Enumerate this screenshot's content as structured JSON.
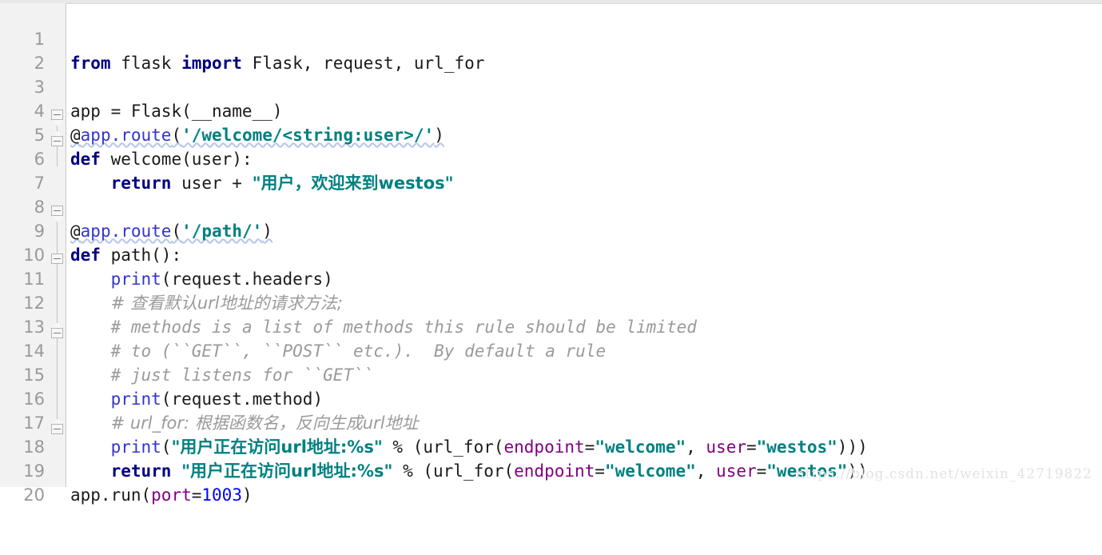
{
  "editor": {
    "language": "python",
    "first_line": 1,
    "last_line": 20,
    "colors": {
      "background": "#ffffff",
      "gutter_background": "#f2f2f2",
      "line_number": "#999999",
      "keyword": "#000080",
      "function": "#3333cc",
      "string": "#008080",
      "comment": "#9a9a9a",
      "number": "#0000ff",
      "keyword_argument": "#800080",
      "plain_text": "#1a1a1a"
    },
    "line_numbers": [
      "1",
      "2",
      "3",
      "4",
      "5",
      "6",
      "7",
      "8",
      "9",
      "10",
      "11",
      "12",
      "13",
      "14",
      "15",
      "16",
      "17",
      "18",
      "19",
      "20"
    ],
    "lines": {
      "l1": {
        "n": "1",
        "text": "from flask import Flask, request, url_for",
        "tokens": [
          {
            "t": "from",
            "c": "kw"
          },
          {
            "t": " flask ",
            "c": "plain"
          },
          {
            "t": "import",
            "c": "kw"
          },
          {
            "t": " Flask, request, url_for",
            "c": "plain"
          }
        ]
      },
      "l2": {
        "n": "2",
        "text": "",
        "tokens": []
      },
      "l3": {
        "n": "3",
        "text": "app = Flask(__name__)",
        "tokens": [
          {
            "t": "app = Flask(__name__)",
            "c": "plain"
          }
        ]
      },
      "l4": {
        "n": "4",
        "text": "@app.route('/welcome/<string:user>/')",
        "tokens": [
          {
            "t": "@",
            "c": "at"
          },
          {
            "t": "app.route",
            "c": "dec"
          },
          {
            "t": "(",
            "c": "plain"
          },
          {
            "t": "'/welcome/<string:user>/'",
            "c": "str"
          },
          {
            "t": ")",
            "c": "plain"
          }
        ]
      },
      "l5": {
        "n": "5",
        "text": "def welcome(user):",
        "tokens": [
          {
            "t": "def",
            "c": "kw"
          },
          {
            "t": " welcome(user):",
            "c": "plain"
          }
        ]
      },
      "l6": {
        "n": "6",
        "text": "    return user + \"用户，欢迎来到westos\"",
        "tokens": [
          {
            "t": "    ",
            "c": "plain"
          },
          {
            "t": "return",
            "c": "kw"
          },
          {
            "t": " user + ",
            "c": "plain"
          },
          {
            "t": "\"用户，欢迎来到westos\"",
            "c": "str"
          }
        ]
      },
      "l7": {
        "n": "7",
        "text": "",
        "tokens": []
      },
      "l8": {
        "n": "8",
        "text": "@app.route('/path/')",
        "tokens": [
          {
            "t": "@",
            "c": "at"
          },
          {
            "t": "app.route",
            "c": "dec"
          },
          {
            "t": "(",
            "c": "plain"
          },
          {
            "t": "'/path/'",
            "c": "str"
          },
          {
            "t": ")",
            "c": "plain"
          }
        ]
      },
      "l9": {
        "n": "9",
        "text": "def path():",
        "tokens": [
          {
            "t": "def",
            "c": "kw"
          },
          {
            "t": " path():",
            "c": "plain"
          }
        ]
      },
      "l10": {
        "n": "10",
        "text": "    print(request.headers)",
        "tokens": [
          {
            "t": "    ",
            "c": "plain"
          },
          {
            "t": "print",
            "c": "fn"
          },
          {
            "t": "(request.headers)",
            "c": "plain"
          }
        ]
      },
      "l11": {
        "n": "11",
        "text": "    # 查看默认url地址的请求方法;",
        "tokens": [
          {
            "t": "    ",
            "c": "plain"
          },
          {
            "t": "# 查看默认url地址的请求方法;",
            "c": "cmt"
          }
        ]
      },
      "l12": {
        "n": "12",
        "text": "    # methods is a list of methods this rule should be limited",
        "tokens": [
          {
            "t": "    ",
            "c": "plain"
          },
          {
            "t": "# methods is a list of methods this rule should be limited",
            "c": "cmt"
          }
        ]
      },
      "l13": {
        "n": "13",
        "text": "    # to (``GET``, ``POST`` etc.).  By default a rule",
        "tokens": [
          {
            "t": "    ",
            "c": "plain"
          },
          {
            "t": "# to (``GET``, ``POST`` etc.).  By default a rule",
            "c": "cmt"
          }
        ]
      },
      "l14": {
        "n": "14",
        "text": "    # just listens for ``GET``",
        "tokens": [
          {
            "t": "    ",
            "c": "plain"
          },
          {
            "t": "# just listens for ``GET``",
            "c": "cmt"
          }
        ]
      },
      "l15": {
        "n": "15",
        "text": "    print(request.method)",
        "tokens": [
          {
            "t": "    ",
            "c": "plain"
          },
          {
            "t": "print",
            "c": "fn"
          },
          {
            "t": "(request.method)",
            "c": "plain"
          }
        ]
      },
      "l16": {
        "n": "16",
        "text": "    # url_for: 根据函数名，反向生成url地址",
        "tokens": [
          {
            "t": "    ",
            "c": "plain"
          },
          {
            "t": "# url_for: 根据函数名，反向生成url地址",
            "c": "cmt"
          }
        ]
      },
      "l17": {
        "n": "17",
        "text": "    print(\"用户正在访问url地址:%s\" % (url_for(endpoint=\"welcome\", user=\"westos\")))",
        "tokens": [
          {
            "t": "    ",
            "c": "plain"
          },
          {
            "t": "print",
            "c": "fn"
          },
          {
            "t": "(",
            "c": "plain"
          },
          {
            "t": "\"用户正在访问url地址:%s\"",
            "c": "str"
          },
          {
            "t": " % (url_for(",
            "c": "plain"
          },
          {
            "t": "endpoint",
            "c": "kwarg"
          },
          {
            "t": "=",
            "c": "plain"
          },
          {
            "t": "\"welcome\"",
            "c": "str"
          },
          {
            "t": ", ",
            "c": "plain"
          },
          {
            "t": "user",
            "c": "kwarg"
          },
          {
            "t": "=",
            "c": "plain"
          },
          {
            "t": "\"westos\"",
            "c": "str"
          },
          {
            "t": ")))",
            "c": "plain"
          }
        ]
      },
      "l18": {
        "n": "18",
        "text": "    return \"用户正在访问url地址:%s\" % (url_for(endpoint=\"welcome\", user=\"westos\"))",
        "tokens": [
          {
            "t": "    ",
            "c": "plain"
          },
          {
            "t": "return",
            "c": "kw"
          },
          {
            "t": " ",
            "c": "plain"
          },
          {
            "t": "\"用户正在访问url地址:%s\"",
            "c": "str"
          },
          {
            "t": " % (url_for(",
            "c": "plain"
          },
          {
            "t": "endpoint",
            "c": "kwarg"
          },
          {
            "t": "=",
            "c": "plain"
          },
          {
            "t": "\"welcome\"",
            "c": "str"
          },
          {
            "t": ", ",
            "c": "plain"
          },
          {
            "t": "user",
            "c": "kwarg"
          },
          {
            "t": "=",
            "c": "plain"
          },
          {
            "t": "\"westos\"",
            "c": "str"
          },
          {
            "t": "))",
            "c": "plain"
          }
        ]
      },
      "l19": {
        "n": "19",
        "text": "app.run(port=1003)",
        "tokens": [
          {
            "t": "app.run(",
            "c": "plain"
          },
          {
            "t": "port",
            "c": "kwarg"
          },
          {
            "t": "=",
            "c": "plain"
          },
          {
            "t": "1003",
            "c": "num"
          },
          {
            "t": ")",
            "c": "plain"
          }
        ]
      },
      "l20": {
        "n": "20",
        "text": "",
        "tokens": []
      }
    }
  },
  "watermark": {
    "text": "https://blog.csdn.net/weixin_42719822"
  }
}
